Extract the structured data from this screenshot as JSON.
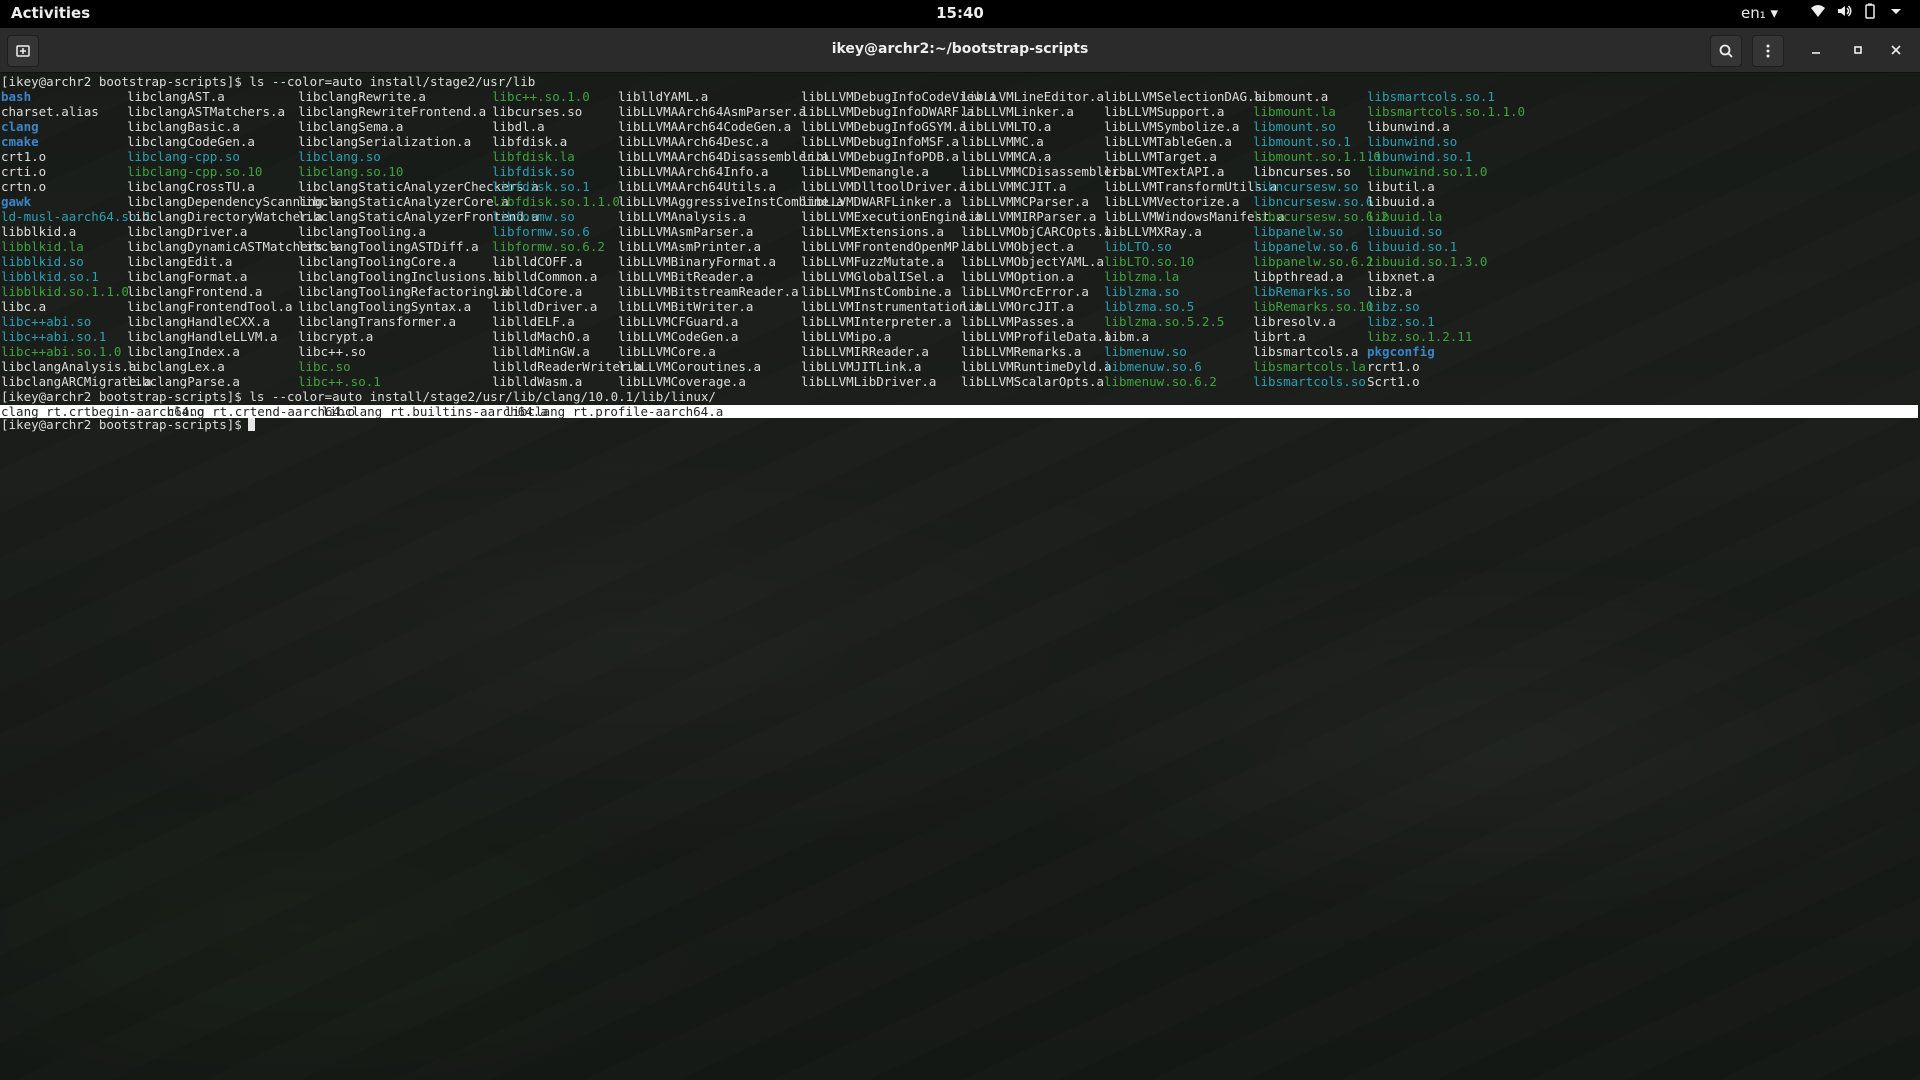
{
  "topbar": {
    "activities": "Activities",
    "clock": "15:40",
    "lang": "en₁ ▾"
  },
  "window": {
    "title": "ikey@archr2:~/bootstrap-scripts"
  },
  "terminal": {
    "prompt": "[ikey@archr2 bootstrap-scripts]$",
    "cmd1": "ls --color=auto install/stage2/usr/lib",
    "cmd2": "ls --color=auto install/stage2/usr/lib/clang/10.0.1/lib/linux/",
    "colors": {
      "blue": "#3a86c8",
      "cyan": "#2aa1b3",
      "green": "#3fa33f",
      "white": "#dcdcdc"
    },
    "columns": [
      [
        [
          "bash",
          "blue"
        ],
        [
          "charset.alias",
          "white"
        ],
        [
          "clang",
          "blue"
        ],
        [
          "cmake",
          "blue"
        ],
        [
          "crt1.o",
          "white"
        ],
        [
          "crti.o",
          "white"
        ],
        [
          "crtn.o",
          "white"
        ],
        [
          "gawk",
          "blue"
        ],
        [
          "ld-musl-aarch64.so.1",
          "cyan"
        ],
        [
          "libblkid.a",
          "white"
        ],
        [
          "libblkid.la",
          "green"
        ],
        [
          "libblkid.so",
          "cyan"
        ],
        [
          "libblkid.so.1",
          "cyan"
        ],
        [
          "libblkid.so.1.1.0",
          "green"
        ],
        [
          "libc.a",
          "white"
        ],
        [
          "libc++abi.so",
          "cyan"
        ],
        [
          "libc++abi.so.1",
          "cyan"
        ],
        [
          "libc++abi.so.1.0",
          "green"
        ],
        [
          "libclangAnalysis.a",
          "white"
        ],
        [
          "libclangARCMigrate.a",
          "white"
        ]
      ],
      [
        [
          "libclangAST.a",
          "white"
        ],
        [
          "libclangASTMatchers.a",
          "white"
        ],
        [
          "libclangBasic.a",
          "white"
        ],
        [
          "libclangCodeGen.a",
          "white"
        ],
        [
          "libclang-cpp.so",
          "cyan"
        ],
        [
          "libclang-cpp.so.10",
          "green"
        ],
        [
          "libclangCrossTU.a",
          "white"
        ],
        [
          "libclangDependencyScanning.a",
          "white"
        ],
        [
          "libclangDirectoryWatcher.a",
          "white"
        ],
        [
          "libclangDriver.a",
          "white"
        ],
        [
          "libclangDynamicASTMatchers.a",
          "white"
        ],
        [
          "libclangEdit.a",
          "white"
        ],
        [
          "libclangFormat.a",
          "white"
        ],
        [
          "libclangFrontend.a",
          "white"
        ],
        [
          "libclangFrontendTool.a",
          "white"
        ],
        [
          "libclangHandleCXX.a",
          "white"
        ],
        [
          "libclangHandleLLVM.a",
          "white"
        ],
        [
          "libclangIndex.a",
          "white"
        ],
        [
          "libclangLex.a",
          "white"
        ],
        [
          "libclangParse.a",
          "white"
        ]
      ],
      [
        [
          "libclangRewrite.a",
          "white"
        ],
        [
          "libclangRewriteFrontend.a",
          "white"
        ],
        [
          "libclangSema.a",
          "white"
        ],
        [
          "libclangSerialization.a",
          "white"
        ],
        [
          "libclang.so",
          "cyan"
        ],
        [
          "libclang.so.10",
          "green"
        ],
        [
          "libclangStaticAnalyzerCheckers.a",
          "white"
        ],
        [
          "libclangStaticAnalyzerCore.a",
          "white"
        ],
        [
          "libclangStaticAnalyzerFrontend.a",
          "white"
        ],
        [
          "libclangTooling.a",
          "white"
        ],
        [
          "libclangToolingASTDiff.a",
          "white"
        ],
        [
          "libclangToolingCore.a",
          "white"
        ],
        [
          "libclangToolingInclusions.a",
          "white"
        ],
        [
          "libclangToolingRefactoring.a",
          "white"
        ],
        [
          "libclangToolingSyntax.a",
          "white"
        ],
        [
          "libclangTransformer.a",
          "white"
        ],
        [
          "libcrypt.a",
          "white"
        ],
        [
          "libc++.so",
          "white"
        ],
        [
          "libc.so",
          "green"
        ],
        [
          "libc++.so.1",
          "green"
        ]
      ],
      [
        [
          "libc++.so.1.0",
          "green"
        ],
        [
          "libcurses.so",
          "white"
        ],
        [
          "libdl.a",
          "white"
        ],
        [
          "libfdisk.a",
          "white"
        ],
        [
          "libfdisk.la",
          "green"
        ],
        [
          "libfdisk.so",
          "cyan"
        ],
        [
          "libfdisk.so.1",
          "cyan"
        ],
        [
          "libfdisk.so.1.1.0",
          "green"
        ],
        [
          "libformw.so",
          "cyan"
        ],
        [
          "libformw.so.6",
          "cyan"
        ],
        [
          "libformw.so.6.2",
          "green"
        ],
        [
          "liblldCOFF.a",
          "white"
        ],
        [
          "liblldCommon.a",
          "white"
        ],
        [
          "liblldCore.a",
          "white"
        ],
        [
          "liblldDriver.a",
          "white"
        ],
        [
          "liblldELF.a",
          "white"
        ],
        [
          "liblldMachO.a",
          "white"
        ],
        [
          "liblldMinGW.a",
          "white"
        ],
        [
          "liblldReaderWriter.a",
          "white"
        ],
        [
          "liblldWasm.a",
          "white"
        ]
      ],
      [
        [
          "liblldYAML.a",
          "white"
        ],
        [
          "libLLVMAArch64AsmParser.a",
          "white"
        ],
        [
          "libLLVMAArch64CodeGen.a",
          "white"
        ],
        [
          "libLLVMAArch64Desc.a",
          "white"
        ],
        [
          "libLLVMAArch64Disassembler.a",
          "white"
        ],
        [
          "libLLVMAArch64Info.a",
          "white"
        ],
        [
          "libLLVMAArch64Utils.a",
          "white"
        ],
        [
          "libLLVMAggressiveInstCombine.a",
          "white"
        ],
        [
          "libLLVMAnalysis.a",
          "white"
        ],
        [
          "libLLVMAsmParser.a",
          "white"
        ],
        [
          "libLLVMAsmPrinter.a",
          "white"
        ],
        [
          "libLLVMBinaryFormat.a",
          "white"
        ],
        [
          "libLLVMBitReader.a",
          "white"
        ],
        [
          "libLLVMBitstreamReader.a",
          "white"
        ],
        [
          "libLLVMBitWriter.a",
          "white"
        ],
        [
          "libLLVMCFGuard.a",
          "white"
        ],
        [
          "libLLVMCodeGen.a",
          "white"
        ],
        [
          "libLLVMCore.a",
          "white"
        ],
        [
          "libLLVMCoroutines.a",
          "white"
        ],
        [
          "libLLVMCoverage.a",
          "white"
        ]
      ],
      [
        [
          "libLLVMDebugInfoCodeView.a",
          "white"
        ],
        [
          "libLLVMDebugInfoDWARF.a",
          "white"
        ],
        [
          "libLLVMDebugInfoGSYM.a",
          "white"
        ],
        [
          "libLLVMDebugInfoMSF.a",
          "white"
        ],
        [
          "libLLVMDebugInfoPDB.a",
          "white"
        ],
        [
          "libLLVMDemangle.a",
          "white"
        ],
        [
          "libLLVMDlltoolDriver.a",
          "white"
        ],
        [
          "libLLVMDWARFLinker.a",
          "white"
        ],
        [
          "libLLVMExecutionEngine.a",
          "white"
        ],
        [
          "libLLVMExtensions.a",
          "white"
        ],
        [
          "libLLVMFrontendOpenMP.a",
          "white"
        ],
        [
          "libLLVMFuzzMutate.a",
          "white"
        ],
        [
          "libLLVMGlobalISel.a",
          "white"
        ],
        [
          "libLLVMInstCombine.a",
          "white"
        ],
        [
          "libLLVMInstrumentation.a",
          "white"
        ],
        [
          "libLLVMInterpreter.a",
          "white"
        ],
        [
          "libLLVMipo.a",
          "white"
        ],
        [
          "libLLVMIRReader.a",
          "white"
        ],
        [
          "libLLVMJITLink.a",
          "white"
        ],
        [
          "libLLVMLibDriver.a",
          "white"
        ]
      ],
      [
        [
          "libLLVMLineEditor.a",
          "white"
        ],
        [
          "libLLVMLinker.a",
          "white"
        ],
        [
          "libLLVMLTO.a",
          "white"
        ],
        [
          "libLLVMMC.a",
          "white"
        ],
        [
          "libLLVMMCA.a",
          "white"
        ],
        [
          "libLLVMMCDisassembler.a",
          "white"
        ],
        [
          "libLLVMMCJIT.a",
          "white"
        ],
        [
          "libLLVMMCParser.a",
          "white"
        ],
        [
          "libLLVMMIRParser.a",
          "white"
        ],
        [
          "libLLVMObjCARCOpts.a",
          "white"
        ],
        [
          "libLLVMObject.a",
          "white"
        ],
        [
          "libLLVMObjectYAML.a",
          "white"
        ],
        [
          "libLLVMOption.a",
          "white"
        ],
        [
          "libLLVMOrcError.a",
          "white"
        ],
        [
          "libLLVMOrcJIT.a",
          "white"
        ],
        [
          "libLLVMPasses.a",
          "white"
        ],
        [
          "libLLVMProfileData.a",
          "white"
        ],
        [
          "libLLVMRemarks.a",
          "white"
        ],
        [
          "libLLVMRuntimeDyld.a",
          "white"
        ],
        [
          "libLLVMScalarOpts.a",
          "white"
        ]
      ],
      [
        [
          "libLLVMSelectionDAG.a",
          "white"
        ],
        [
          "libLLVMSupport.a",
          "white"
        ],
        [
          "libLLVMSymbolize.a",
          "white"
        ],
        [
          "libLLVMTableGen.a",
          "white"
        ],
        [
          "libLLVMTarget.a",
          "white"
        ],
        [
          "libLLVMTextAPI.a",
          "white"
        ],
        [
          "libLLVMTransformUtils.a",
          "white"
        ],
        [
          "libLLVMVectorize.a",
          "white"
        ],
        [
          "libLLVMWindowsManifest.a",
          "white"
        ],
        [
          "libLLVMXRay.a",
          "white"
        ],
        [
          "libLTO.so",
          "cyan"
        ],
        [
          "libLTO.so.10",
          "green"
        ],
        [
          "liblzma.la",
          "green"
        ],
        [
          "liblzma.so",
          "cyan"
        ],
        [
          "liblzma.so.5",
          "cyan"
        ],
        [
          "liblzma.so.5.2.5",
          "green"
        ],
        [
          "libm.a",
          "white"
        ],
        [
          "libmenuw.so",
          "cyan"
        ],
        [
          "libmenuw.so.6",
          "cyan"
        ],
        [
          "libmenuw.so.6.2",
          "green"
        ]
      ],
      [
        [
          "libmount.a",
          "white"
        ],
        [
          "libmount.la",
          "green"
        ],
        [
          "libmount.so",
          "cyan"
        ],
        [
          "libmount.so.1",
          "cyan"
        ],
        [
          "libmount.so.1.1.0",
          "green"
        ],
        [
          "libncurses.so",
          "white"
        ],
        [
          "libncursesw.so",
          "cyan"
        ],
        [
          "libncursesw.so.6",
          "cyan"
        ],
        [
          "libncursesw.so.6.2",
          "green"
        ],
        [
          "libpanelw.so",
          "cyan"
        ],
        [
          "libpanelw.so.6",
          "cyan"
        ],
        [
          "libpanelw.so.6.2",
          "green"
        ],
        [
          "libpthread.a",
          "white"
        ],
        [
          "libRemarks.so",
          "cyan"
        ],
        [
          "libRemarks.so.10",
          "green"
        ],
        [
          "libresolv.a",
          "white"
        ],
        [
          "librt.a",
          "white"
        ],
        [
          "libsmartcols.a",
          "white"
        ],
        [
          "libsmartcols.la",
          "green"
        ],
        [
          "libsmartcols.so",
          "cyan"
        ]
      ],
      [
        [
          "libsmartcols.so.1",
          "cyan"
        ],
        [
          "libsmartcols.so.1.1.0",
          "green"
        ],
        [
          "libunwind.a",
          "white"
        ],
        [
          "libunwind.so",
          "cyan"
        ],
        [
          "libunwind.so.1",
          "cyan"
        ],
        [
          "libunwind.so.1.0",
          "green"
        ],
        [
          "libutil.a",
          "white"
        ],
        [
          "libuuid.a",
          "white"
        ],
        [
          "libuuid.la",
          "green"
        ],
        [
          "libuuid.so",
          "cyan"
        ],
        [
          "libuuid.so.1",
          "cyan"
        ],
        [
          "libuuid.so.1.3.0",
          "green"
        ],
        [
          "libxnet.a",
          "white"
        ],
        [
          "libz.a",
          "white"
        ],
        [
          "libz.so",
          "cyan"
        ],
        [
          "libz.so.1",
          "cyan"
        ],
        [
          "libz.so.1.2.11",
          "green"
        ],
        [
          "pkgconfig",
          "blue"
        ],
        [
          "rcrt1.o",
          "white"
        ],
        [
          "Scrt1.o",
          "white"
        ]
      ]
    ],
    "listing2": [
      "clang_rt.crtbegin-aarch64.o",
      "clang_rt.crtend-aarch64.o",
      "libclang_rt.builtins-aarch64.a",
      "libclang_rt.profile-aarch64.a"
    ]
  }
}
